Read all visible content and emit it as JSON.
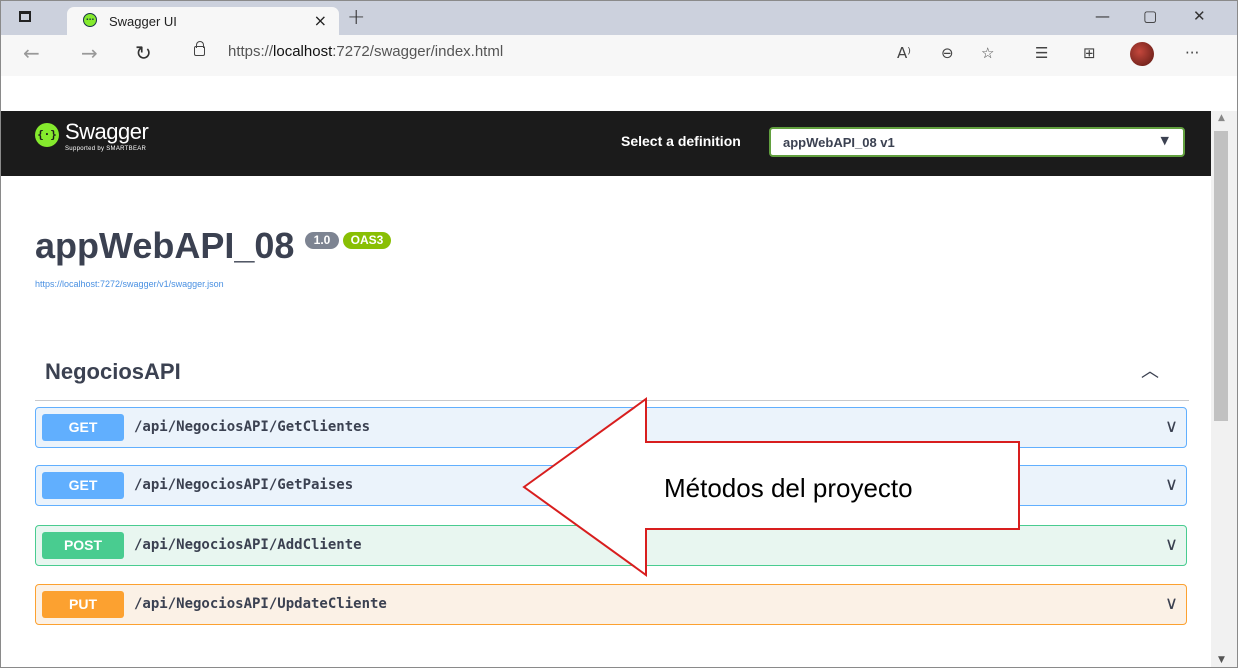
{
  "browser": {
    "tab_title": "Swagger UI",
    "tab_favicon": "{-}",
    "close_glyph": "×",
    "new_tab_glyph": "+",
    "minimize_glyph": "—",
    "restore_glyph": "▢",
    "window_close_glyph": "✕",
    "url_prefix": "https://",
    "url_host": "localhost",
    "url_rest": ":7272/swagger/index.html",
    "toolbar_icons": [
      "read-aloud-icon",
      "zoom-icon",
      "add-favorite-icon",
      "favorites-icon",
      "collections-icon",
      "profile-avatar",
      "more-icon"
    ],
    "read_aloud_glyph": "A⁾",
    "zoom_glyph": "⊖",
    "fav_add_glyph": "☆",
    "favorites_glyph": "☰",
    "collections_glyph": "⊞",
    "more_glyph": "···",
    "back_glyph": "←",
    "forward_glyph": "→",
    "refresh_glyph": "↻"
  },
  "swagger": {
    "logo_text": "Swagger",
    "logo_icon": "{···}",
    "logo_sub": "Supported by SMARTBEAR",
    "select_label": "Select a definition",
    "selected_definition": "appWebAPI_08 v1",
    "select_chevron": "⌄"
  },
  "info": {
    "title": "appWebAPI_08",
    "version": "1.0",
    "oas": "OAS3",
    "spec_url": "https://localhost:7272/swagger/v1/swagger.json"
  },
  "tag": {
    "name": "NegociosAPI",
    "chevron": "^"
  },
  "operations": [
    {
      "method": "GET",
      "path": "/api/NegociosAPI/GetClientes",
      "chevron": "∨"
    },
    {
      "method": "GET",
      "path": "/api/NegociosAPI/GetPaises",
      "chevron": "∨"
    },
    {
      "method": "POST",
      "path": "/api/NegociosAPI/AddCliente",
      "chevron": "∨"
    },
    {
      "method": "PUT",
      "path": "/api/NegociosAPI/UpdateCliente",
      "chevron": "∨"
    }
  ],
  "annotation": {
    "text": "Métodos del proyecto",
    "color": "#d81e1e"
  },
  "colors": {
    "get": "#61affe",
    "post": "#49cc90",
    "put": "#fca130",
    "swagger_green": "#85ea2d",
    "topbar": "#1b1b1b"
  }
}
